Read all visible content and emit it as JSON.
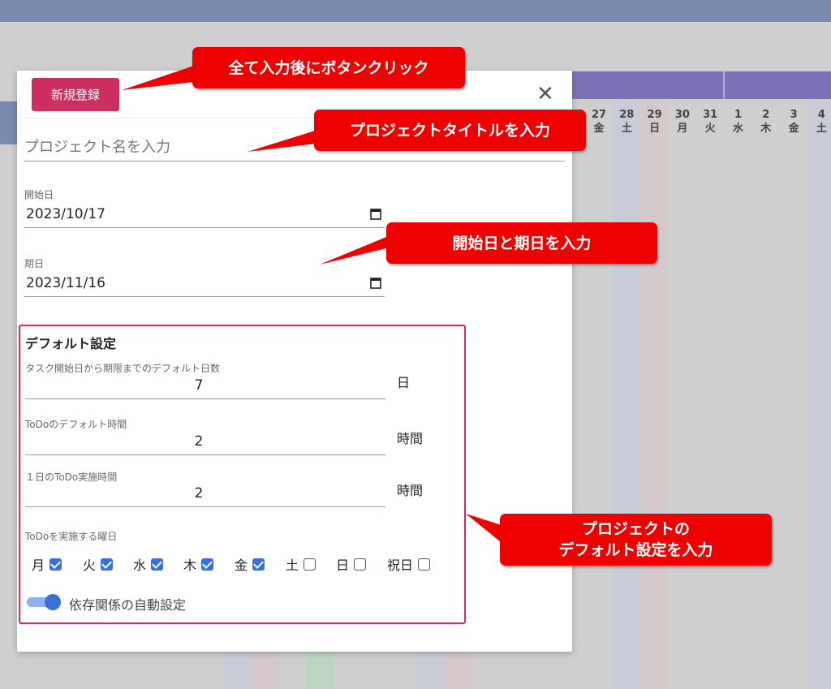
{
  "background": {
    "days": [
      {
        "num": "27",
        "dow": "金"
      },
      {
        "num": "28",
        "dow": "土"
      },
      {
        "num": "29",
        "dow": "日"
      },
      {
        "num": "30",
        "dow": "月"
      },
      {
        "num": "31",
        "dow": "火"
      },
      {
        "num": "1",
        "dow": "水"
      },
      {
        "num": "2",
        "dow": "木"
      },
      {
        "num": "3",
        "dow": "金"
      },
      {
        "num": "4",
        "dow": "土"
      }
    ]
  },
  "dialog": {
    "register_label": "新規登録",
    "close_label": "✕",
    "title_placeholder": "プロジェクト名を入力",
    "start_label": "開始日",
    "start_value": "2023/10/17",
    "due_label": "期日",
    "due_value": "2023/11/16",
    "defaults": {
      "section_title": "デフォルト設定",
      "task_days_label": "タスク開始日から期限までのデフォルト日数",
      "task_days_value": "7",
      "task_days_unit": "日",
      "todo_time_label": "ToDoのデフォルト時間",
      "todo_time_value": "2",
      "todo_time_unit": "時間",
      "daily_time_label": "１日のToDo実施時間",
      "daily_time_value": "2",
      "daily_time_unit": "時間",
      "weekdays_label": "ToDoを実施する曜日",
      "weekdays": [
        {
          "label": "月",
          "checked": true
        },
        {
          "label": "火",
          "checked": true
        },
        {
          "label": "水",
          "checked": true
        },
        {
          "label": "木",
          "checked": true
        },
        {
          "label": "金",
          "checked": true
        },
        {
          "label": "土",
          "checked": false
        },
        {
          "label": "日",
          "checked": false
        },
        {
          "label": "祝日",
          "checked": false
        }
      ],
      "auto_dependency_label": "依存関係の自動設定",
      "auto_dependency_on": true
    }
  },
  "callouts": {
    "register": "全て入力後にボタンクリック",
    "title": "プロジェクトタイトルを入力",
    "dates": "開始日と期日を入力",
    "defaults_line1": "プロジェクトの",
    "defaults_line2": "デフォルト設定を入力"
  },
  "colors": {
    "accent": "#cc2f5f",
    "callout": "#ee0000",
    "checkbox": "#3b6fd8",
    "highlight_border": "#e0245a"
  }
}
